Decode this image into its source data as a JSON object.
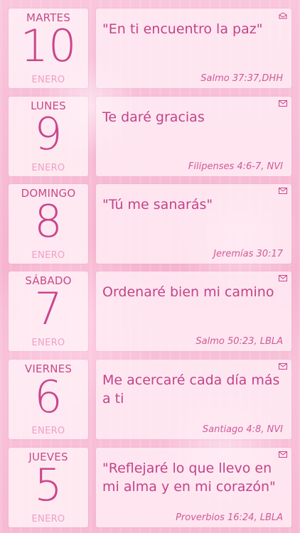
{
  "colors": {
    "accent": "#c8468c",
    "month_text": "#ef9fc3",
    "card_bg": "#fff0f6"
  },
  "entries": [
    {
      "weekday": "MARTES",
      "day": "10",
      "month": "ENERO",
      "verse": "\"En ti encuentro la paz\"",
      "reference": "Salmo 37:37,DHH",
      "icon": "open-envelope-icon"
    },
    {
      "weekday": "LUNES",
      "day": "9",
      "month": "ENERO",
      "verse": "Te daré gracias",
      "reference": "Filipenses 4:6-7, NVI",
      "icon": "envelope-icon"
    },
    {
      "weekday": "DOMINGO",
      "day": "8",
      "month": "ENERO",
      "verse": "\"Tú me sanarás\"",
      "reference": "Jeremías 30:17",
      "icon": "envelope-icon"
    },
    {
      "weekday": "SÁBADO",
      "day": "7",
      "month": "ENERO",
      "verse": "Ordenaré bien mi camino",
      "reference": "Salmo 50:23, LBLA",
      "icon": "envelope-icon"
    },
    {
      "weekday": "VIERNES",
      "day": "6",
      "month": "ENERO",
      "verse": "Me acercaré cada día más a ti",
      "reference": "Santiago 4:8, NVI",
      "icon": "envelope-icon"
    },
    {
      "weekday": "JUEVES",
      "day": "5",
      "month": "ENERO",
      "verse": "\"Reflejaré lo que llevo en mi alma y en mi corazón\"",
      "reference": "Proverbios 16:24, LBLA",
      "icon": "envelope-icon"
    }
  ]
}
